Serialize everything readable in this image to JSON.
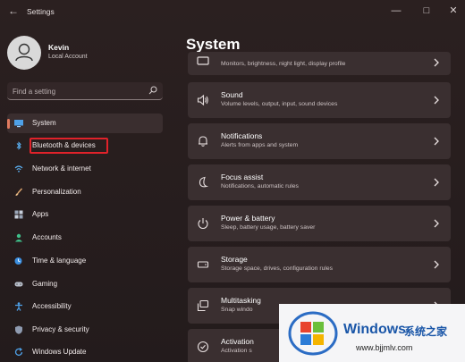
{
  "window": {
    "title": "Settings"
  },
  "profile": {
    "name": "Kevin",
    "account_type": "Local Account"
  },
  "search": {
    "placeholder": "Find a setting"
  },
  "sidebar": {
    "items": [
      {
        "label": "System",
        "icon": "monitor-icon",
        "active": true
      },
      {
        "label": "Bluetooth & devices",
        "icon": "bluetooth-icon",
        "active": false,
        "highlighted": true
      },
      {
        "label": "Network & internet",
        "icon": "wifi-icon",
        "active": false
      },
      {
        "label": "Personalization",
        "icon": "brush-icon",
        "active": false
      },
      {
        "label": "Apps",
        "icon": "apps-icon",
        "active": false
      },
      {
        "label": "Accounts",
        "icon": "person-icon",
        "active": false
      },
      {
        "label": "Time & language",
        "icon": "globe-clock-icon",
        "active": false
      },
      {
        "label": "Gaming",
        "icon": "gamepad-icon",
        "active": false
      },
      {
        "label": "Accessibility",
        "icon": "accessibility-icon",
        "active": false
      },
      {
        "label": "Privacy & security",
        "icon": "shield-icon",
        "active": false
      },
      {
        "label": "Windows Update",
        "icon": "update-icon",
        "active": false
      }
    ]
  },
  "main": {
    "title": "System",
    "cards": [
      {
        "title": "",
        "subtitle": "Monitors, brightness, night light, display profile",
        "icon": "display-icon"
      },
      {
        "title": "Sound",
        "subtitle": "Volume levels, output, input, sound devices",
        "icon": "speaker-icon"
      },
      {
        "title": "Notifications",
        "subtitle": "Alerts from apps and system",
        "icon": "bell-icon"
      },
      {
        "title": "Focus assist",
        "subtitle": "Notifications, automatic rules",
        "icon": "moon-icon"
      },
      {
        "title": "Power & battery",
        "subtitle": "Sleep, battery usage, battery saver",
        "icon": "power-icon"
      },
      {
        "title": "Storage",
        "subtitle": "Storage space, drives, configuration rules",
        "icon": "storage-icon"
      },
      {
        "title": "Multitasking",
        "subtitle": "Snap windo",
        "icon": "multitask-icon"
      },
      {
        "title": "Activation",
        "subtitle": "Activation s",
        "icon": "check-circle-icon"
      }
    ]
  },
  "watermark": {
    "title": "Windows",
    "title_cn": "系统之家",
    "url": "www.bjjmlv.com"
  },
  "colors": {
    "accent": "#e07a5f",
    "highlight_border": "#e0222a",
    "card_bg": "#3a2f30",
    "watermark_text": "#1a56a8"
  }
}
